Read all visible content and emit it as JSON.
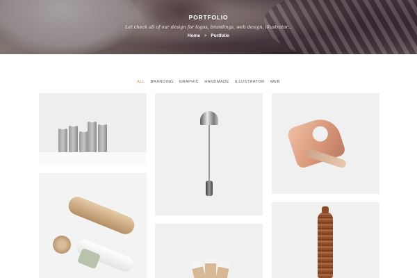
{
  "hero": {
    "title": "PORTFOLIO",
    "subtitle": "Let check all of our design for logos, brandings, web design, illustrator...",
    "breadcrumb": {
      "home": "Home",
      "separator": ">",
      "current": "Portfolio"
    }
  },
  "filters": {
    "items": [
      {
        "label": "ALL",
        "active": true
      },
      {
        "label": "BRANDING",
        "active": false
      },
      {
        "label": "GRAPHIC",
        "active": false
      },
      {
        "label": "HANDMADE",
        "active": false
      },
      {
        "label": "ILLUSTRATOR",
        "active": false
      },
      {
        "label": "WEB",
        "active": false
      }
    ]
  },
  "colors": {
    "accent": "#c8904f",
    "text": "#555555",
    "card_background": "#f0f0f0"
  },
  "portfolio_items": [
    {
      "image": "ceramic-spools-image"
    },
    {
      "image": "metal-pin-lamp-image"
    },
    {
      "image": "wooden-phone-holder-image"
    },
    {
      "image": "kraft-tube-packaging-image"
    },
    {
      "image": "paper-boxes-image"
    },
    {
      "image": "wooden-bottle-image"
    }
  ]
}
